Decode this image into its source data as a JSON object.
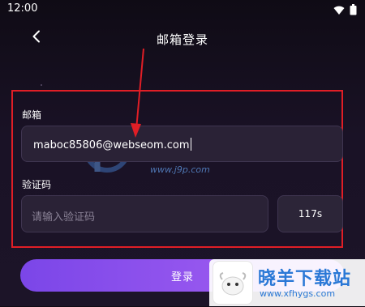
{
  "status_bar": {
    "time": "12:00"
  },
  "nav": {
    "title": "邮箱登录"
  },
  "form": {
    "email_label": "邮箱",
    "email_value": "maboc85806@webseom.com",
    "code_label": "验证码",
    "code_placeholder": "请输入验证码",
    "code_countdown": "117s"
  },
  "login_button": {
    "label": "登录"
  },
  "watermarks": {
    "center_url": "www.j9p.com",
    "corner_brand": "晓羊下载站",
    "corner_url": "www.xfhygs.com"
  },
  "colors": {
    "accent_start": "#7b46e8",
    "accent_end": "#b26cf5",
    "highlight": "#e01e26",
    "background": "#1a1226"
  },
  "icons": [
    "wifi-icon",
    "battery-icon",
    "back-arrow-icon"
  ]
}
